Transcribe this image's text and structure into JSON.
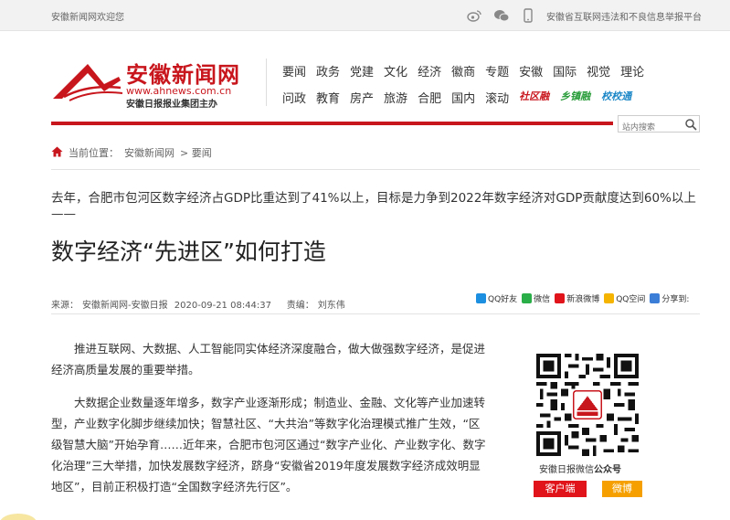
{
  "topbar": {
    "welcome": "安徽新闻网欢迎您",
    "report": "安徽省互联网违法和不良信息举报平台"
  },
  "logo": {
    "brand": "安徽新闻网",
    "url": "www.ahnews.com.cn",
    "group": "安徽日报报业集团主办"
  },
  "nav": {
    "row1": [
      "要闻",
      "政务",
      "党建",
      "文化",
      "经济",
      "徽商",
      "专题",
      "安徽",
      "国际",
      "视觉",
      "理论"
    ],
    "row2": [
      "问政",
      "教育",
      "房产",
      "旅游",
      "合肥",
      "国内",
      "滚动"
    ],
    "special": [
      "社区融",
      "乡镇融",
      "校校通"
    ]
  },
  "search": {
    "placeholder": "站内搜索"
  },
  "breadcrumb": {
    "prefix": "当前位置：",
    "items": [
      "安徽新闻网",
      "> 要闻"
    ]
  },
  "article": {
    "subtitle": "去年，合肥市包河区数字经济占GDP比重达到了41%以上，目标是力争到2022年数字经济对GDP贡献度达到60%以上——",
    "title": "数字经济“先进区”如何打造",
    "source_label": "来源：",
    "source": "安徽新闻网-安徽日报",
    "datetime": "2020-09-21 08:44:37",
    "editor_label": "责编：",
    "editor": "刘东伟",
    "paragraphs": [
      "推进互联网、大数据、人工智能同实体经济深度融合，做大做强数字经济，是促进经济高质量发展的重要举措。",
      "大数据企业数量逐年增多，数字产业逐渐形成；制造业、金融、文化等产业加速转型，产业数字化脚步继续加快；智慧社区、“大共治”等数字化治理模式推广生效，“区级智慧大脑”开始孕育……近年来，合肥市包河区通过“数字产业化、产业数字化、数字化治理”三大举措，加快发展数字经济，跻身“安徽省2019年度发展数字经济成效明显地区”，目前正积极打造“全国数字经济先行区”。"
    ]
  },
  "share": {
    "qq_friend": "QQ好友",
    "wechat": "微信",
    "weibo": "新浪微博",
    "qzone": "QQ空间",
    "more": "分享到:"
  },
  "sidebar": {
    "qr_caption_main": "安徽日报微信",
    "qr_caption_bold": "公众号",
    "client_button": "客户端",
    "weibo_button": "微博"
  },
  "colors": {
    "brand_red": "#c8161d",
    "green": "#2a9d3b",
    "blue": "#1e88c7",
    "orange": "#f5a000"
  }
}
